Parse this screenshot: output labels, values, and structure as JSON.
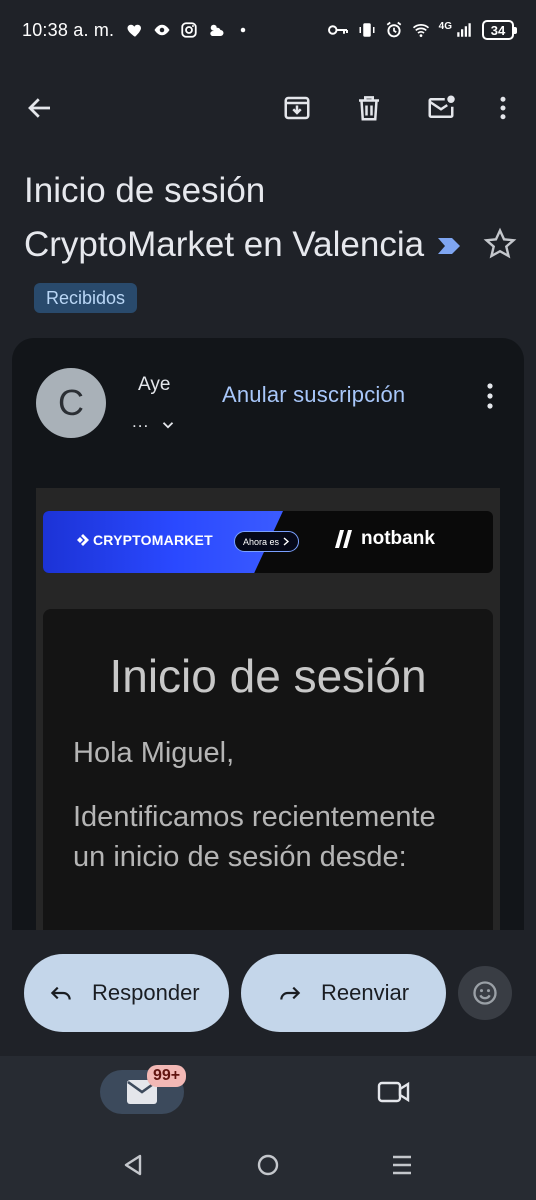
{
  "status_bar": {
    "time": "10:38 a. m.",
    "network": "4G",
    "battery": "34"
  },
  "toolbar": {
    "back": "back-arrow-icon",
    "archive": "archive-icon",
    "delete": "trash-icon",
    "mark_unread": "mark-unread-icon",
    "more": "more-vert-icon"
  },
  "email": {
    "subject": "Inicio de sesión CryptoMarket en Valencia",
    "label": "Recibidos",
    "sender_initial": "C",
    "sender_name": "Aye",
    "recipient_details": "...",
    "unsubscribe": "Anular suscripción"
  },
  "banner": {
    "brand": "CRYPTOMARKET",
    "pill_text": "Ahora es",
    "new_brand": "notbank"
  },
  "body": {
    "title": "Inicio de sesión",
    "greeting": "Hola Miguel,",
    "text": "Identificamos recientemente un inicio de sesión desde:"
  },
  "actions": {
    "reply": "Responder",
    "forward": "Reenviar"
  },
  "bottom_nav": {
    "mail_badge": "99+"
  },
  "colors": {
    "background": "#1f2228",
    "card": "#121519",
    "accent_link": "#a8c7fa",
    "pill_button": "#c4d6ea",
    "label_chip": "#294a6c"
  }
}
